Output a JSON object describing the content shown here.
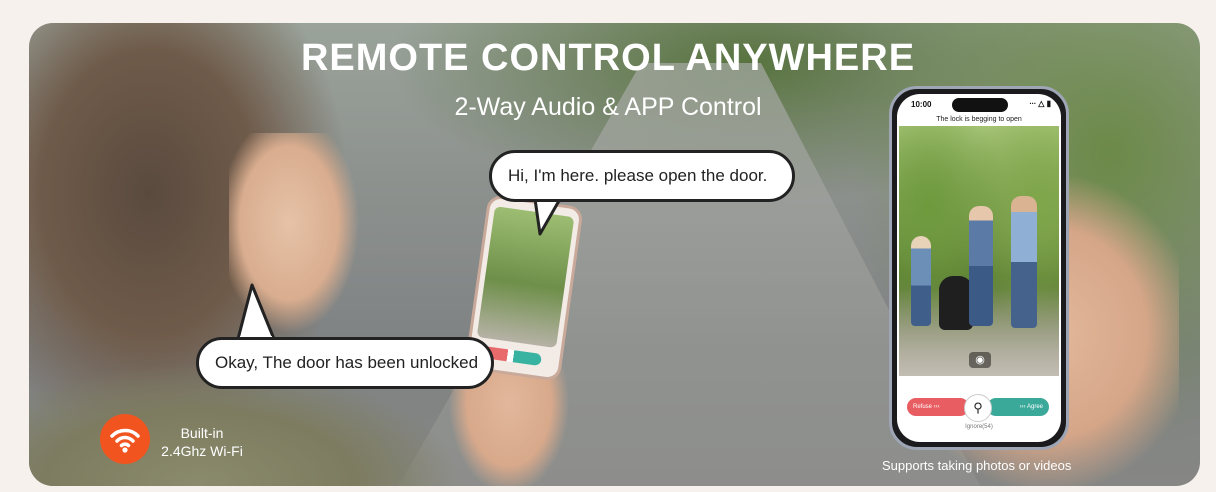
{
  "headline": {
    "title": "REMOTE CONTROL ANYWHERE",
    "subtitle": "2-Way Audio & APP Control"
  },
  "bubbles": {
    "visitor": "Hi, I'm here. please open the door.",
    "owner": "Okay, The door has been unlocked"
  },
  "phone": {
    "status_time": "10:00",
    "status_icons": "∙∙∙ △ ▮",
    "camera_title": "The lock is begging to open",
    "camera_icon": "camera-icon",
    "refuse_label": "Refuse ‹‹‹",
    "agree_label": "››› Agree",
    "unlock_icon": "key-icon",
    "ignore_label": "Ignore(54)"
  },
  "wifi": {
    "icon": "wifi-icon",
    "line1": "Built-in",
    "line2": "2.4Ghz Wi-Fi"
  },
  "caption": "Supports taking photos or videos",
  "colors": {
    "accent_orange": "#f2541f",
    "refuse_red": "#e85d62",
    "agree_teal": "#3aa99a"
  }
}
